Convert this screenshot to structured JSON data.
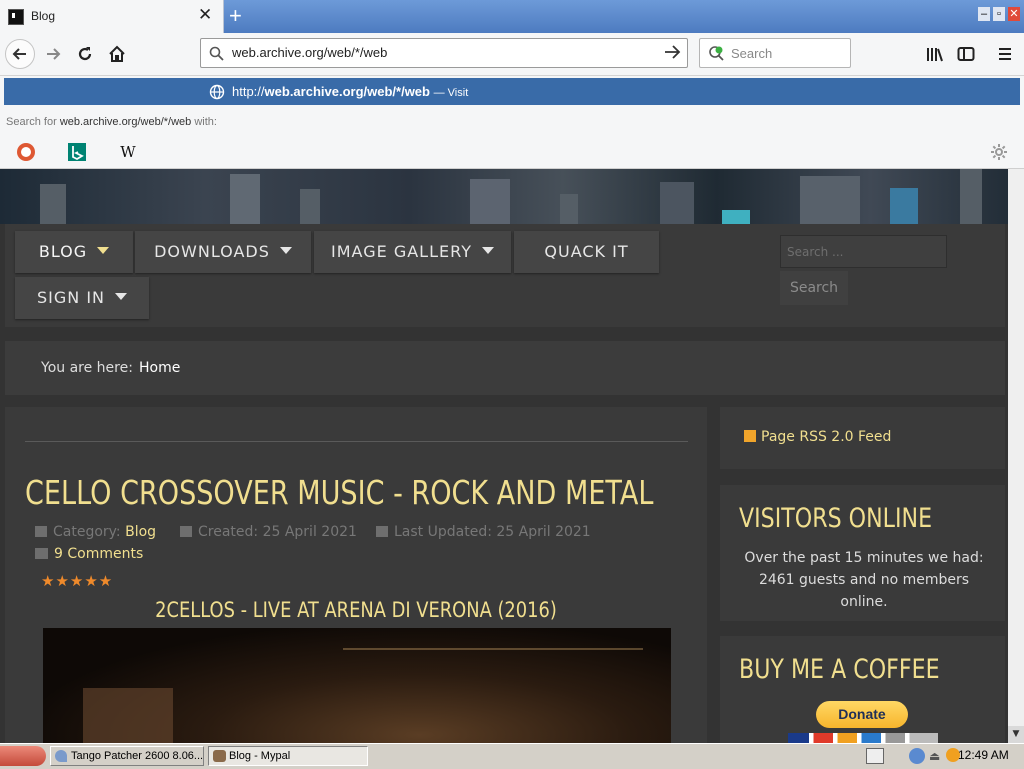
{
  "browser": {
    "tab_title": "Blog",
    "tab_close": "✕",
    "new_tab": "+",
    "url": "web.archive.org/web/*/web",
    "search_placeholder": "Search",
    "suggestion": {
      "prefix": "http://",
      "url": "web.archive.org/web/*/web",
      "action": "— Visit"
    },
    "search_for_prefix": "Search for",
    "search_for_query": "web.archive.org/web/*/web",
    "search_for_suffix": "with:",
    "engines": [
      "duckduckgo-icon",
      "bing-icon",
      "wikipedia-icon"
    ],
    "wiki_glyph": "W"
  },
  "site": {
    "menu": [
      {
        "label": "BLOG",
        "dropdown": true,
        "active": true
      },
      {
        "label": "DOWNLOADS",
        "dropdown": true
      },
      {
        "label": "IMAGE GALLERY",
        "dropdown": true
      },
      {
        "label": "QUACK IT",
        "dropdown": false
      },
      {
        "label": "SIGN IN",
        "dropdown": true
      }
    ],
    "search_placeholder": "Search ...",
    "search_button": "Search",
    "breadcrumb_label": "You are here:",
    "breadcrumb_home": "Home",
    "article": {
      "title": "CELLO CROSSOVER MUSIC - ROCK AND METAL",
      "category_label": "Category:",
      "category": "Blog",
      "created": "Created: 25 April 2021",
      "updated": "Last Updated: 25 April 2021",
      "comments": "9 Comments",
      "rating": 5,
      "stars": "★★★★★",
      "video_title": "2CELLOS - LIVE AT ARENA DI VERONA (2016)"
    },
    "rss": "Page RSS 2.0 Feed",
    "visitors_title": "VISITORS ONLINE",
    "visitors_text": "Over the past 15 minutes we had: 2461 guests and no members online.",
    "coffee_title": "BUY ME A COFFEE",
    "donate": "Donate"
  },
  "taskbar": {
    "tasks": [
      "Tango Patcher 2600 8.06...",
      "Blog - Mypal"
    ],
    "clock": "12:49 AM"
  },
  "colors": {
    "accent": "#f1df8f",
    "suggest_bg": "#396ba8",
    "page_bg": "#333333"
  }
}
